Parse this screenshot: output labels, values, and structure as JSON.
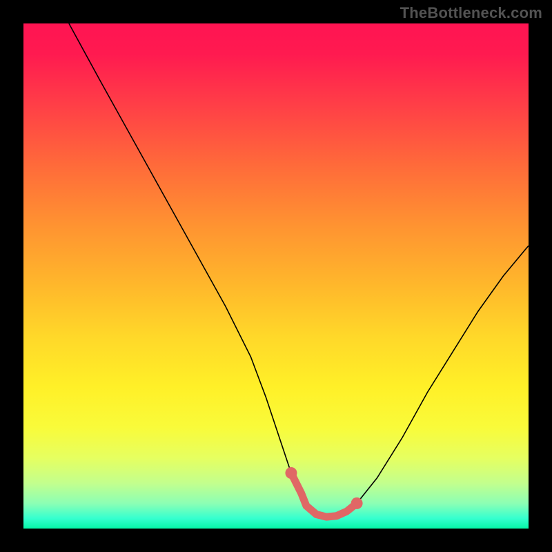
{
  "watermark": "TheBottleneck.com",
  "chart_data": {
    "type": "line",
    "title": "",
    "xlabel": "",
    "ylabel": "",
    "xlim": [
      0,
      100
    ],
    "ylim": [
      0,
      100
    ],
    "grid": false,
    "legend": false,
    "series": [
      {
        "name": "primary-curve",
        "color": "#000000",
        "x": [
          9,
          15,
          20,
          25,
          30,
          35,
          40,
          45,
          48,
          51,
          53,
          55,
          56,
          58,
          60,
          62,
          64,
          66,
          70,
          75,
          80,
          85,
          90,
          95,
          100
        ],
        "y": [
          100,
          89,
          80,
          71,
          62,
          53,
          44,
          34,
          26,
          17,
          11,
          7,
          4.5,
          2.8,
          2.3,
          2.5,
          3.4,
          5,
          10,
          18,
          27,
          35,
          43,
          50,
          56
        ]
      },
      {
        "name": "trough-highlight",
        "color": "#e06765",
        "x": [
          53,
          55,
          56,
          58,
          60,
          62,
          64,
          66
        ],
        "y": [
          11,
          7,
          4.5,
          2.8,
          2.3,
          2.5,
          3.4,
          5
        ]
      }
    ],
    "background_gradient": {
      "stops": [
        {
          "pos": 0.0,
          "color": "#ff1452"
        },
        {
          "pos": 0.5,
          "color": "#ffb82b"
        },
        {
          "pos": 0.8,
          "color": "#f9fb3a"
        },
        {
          "pos": 1.0,
          "color": "#05f6a8"
        }
      ],
      "direction": "vertical"
    }
  }
}
